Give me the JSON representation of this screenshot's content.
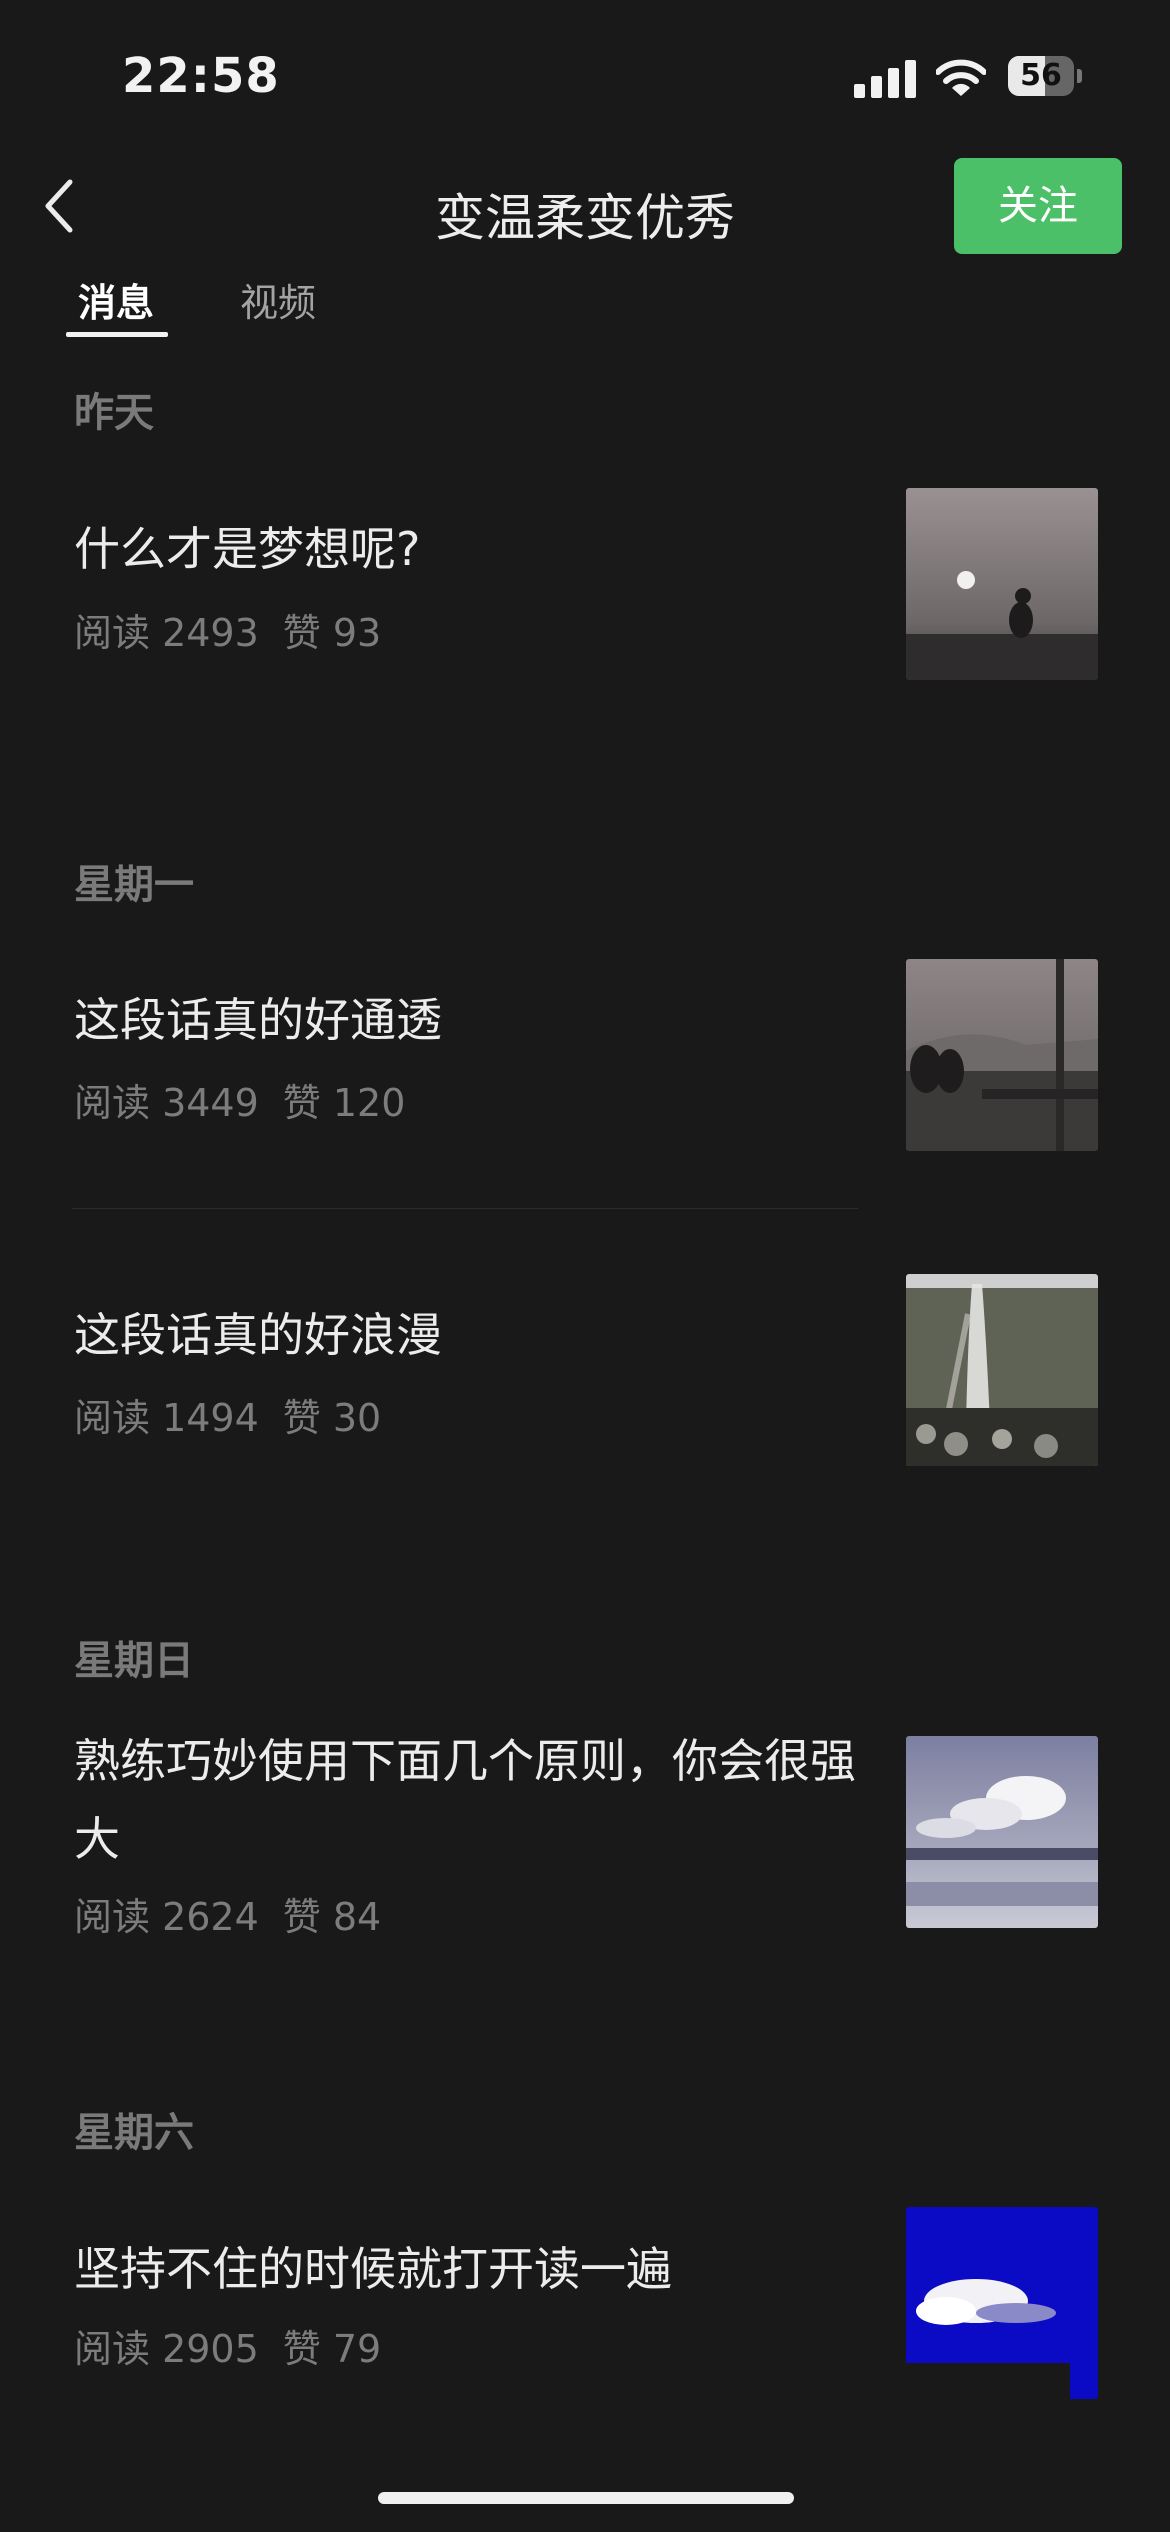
{
  "status_bar": {
    "time": "22:58",
    "battery": "56",
    "battery_level": 0.56
  },
  "nav": {
    "title": "变温柔变优秀",
    "follow_label": "关注"
  },
  "tabs": [
    {
      "label": "消息",
      "active": true
    },
    {
      "label": "视频",
      "active": false
    }
  ],
  "sections": [
    {
      "label": "昨天",
      "articles": [
        {
          "title": "什么才是梦想呢?",
          "reads": "阅读 2493",
          "likes": "赞 93"
        }
      ]
    },
    {
      "label": "星期一",
      "articles": [
        {
          "title": "这段话真的好通透",
          "reads": "阅读 3449",
          "likes": "赞 120"
        },
        {
          "title": "这段话真的好浪漫",
          "reads": "阅读 1494",
          "likes": "赞 30"
        }
      ]
    },
    {
      "label": "星期日",
      "articles": [
        {
          "title": "熟练巧妙使用下面几个原则，你会很强大",
          "reads": "阅读 2624",
          "likes": "赞 84"
        }
      ]
    },
    {
      "label": "星期六",
      "articles": [
        {
          "title": "坚持不住的时候就打开读一遍",
          "reads": "阅读 2905",
          "likes": "赞 79"
        }
      ]
    }
  ],
  "icons": {
    "back": "chevron-left-icon",
    "signal": "cellular-signal-icon",
    "wifi": "wifi-icon",
    "battery": "battery-icon"
  },
  "colors": {
    "background": "#191919",
    "follow_button": "#4cc069",
    "title_text": "#ececec",
    "meta_text": "#7c7c7c"
  }
}
